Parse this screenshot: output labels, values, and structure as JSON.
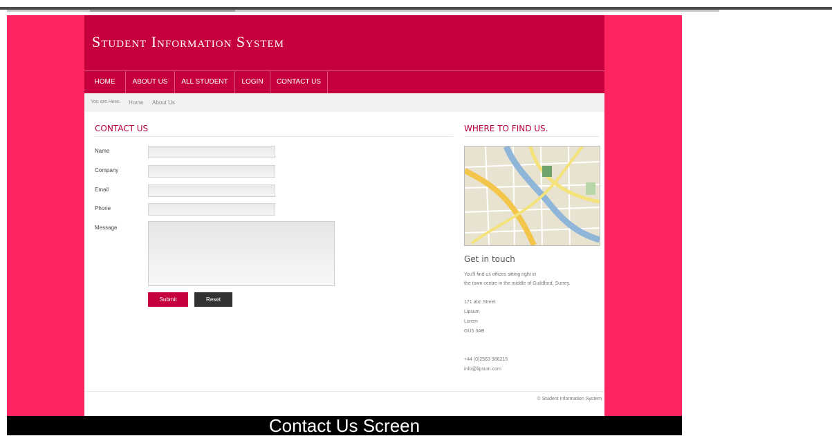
{
  "site": {
    "title": "Student Information System"
  },
  "nav": [
    "HOME",
    "ABOUT US",
    "ALL STUDENT",
    "LOGIN",
    "CONTACT US"
  ],
  "breadcrumb": {
    "prefix": "You are Here:",
    "items": [
      "Home",
      "About Us"
    ]
  },
  "contact": {
    "title": "CONTACT US",
    "fields": [
      "Name",
      "Company",
      "Email",
      "Phone"
    ],
    "message_label": "Message",
    "submit": "Submit",
    "reset": "Reset"
  },
  "sidebar": {
    "title": "WHERE TO FIND US.",
    "get_in_touch": "Get in touch",
    "desc_line1": "You'll find us offices sitting right in",
    "desc_line2": "the town centre in the middle of Guildford, Surrey.",
    "address": [
      "171 abc Street",
      "Lipsum",
      "Lorem",
      "GU5 3AB"
    ],
    "phone": "+44 (0)2563 986215",
    "email": "info@lipsum.com"
  },
  "footer": {
    "text": "© Student Information System"
  },
  "caption": "Contact Us Screen",
  "colors": {
    "header": "#c6003e",
    "background": "#ff2560",
    "reset_button": "#333333"
  }
}
